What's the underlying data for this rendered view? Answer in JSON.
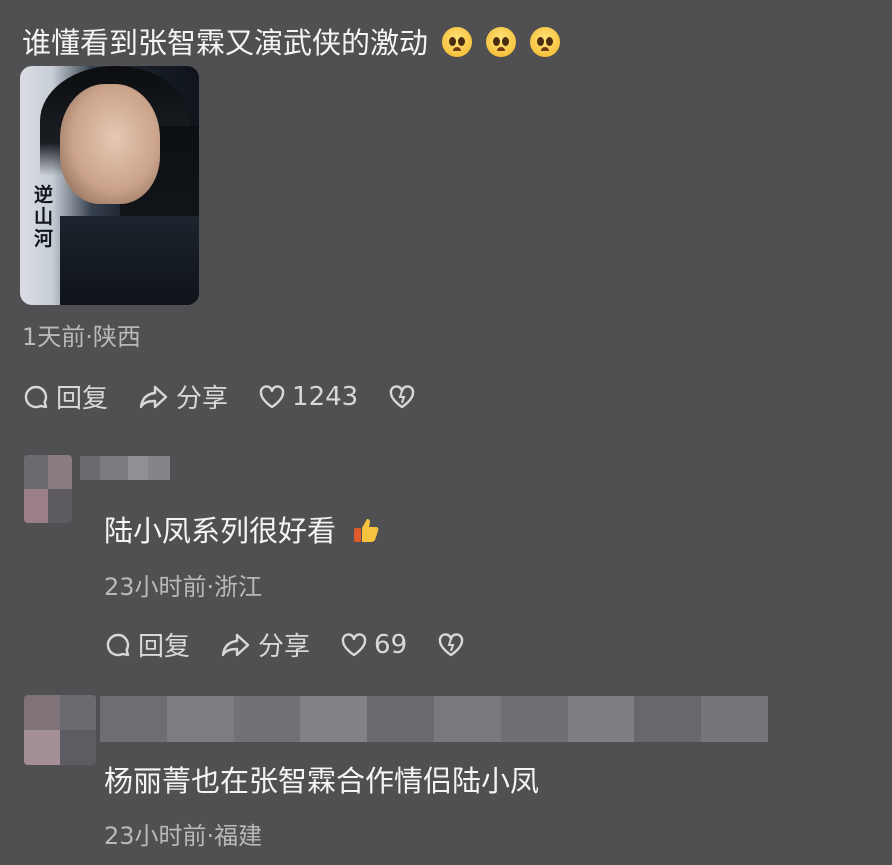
{
  "comments": [
    {
      "text": "谁懂看到张智霖又演武侠的激动",
      "emojis": [
        "pleading-face-icon",
        "pleading-face-icon",
        "pleading-face-icon"
      ],
      "meta": "1天前·陕西",
      "actions": {
        "reply": "回复",
        "share": "分享",
        "likes": "1243"
      },
      "image": {
        "poster_text": "逆山河"
      }
    },
    {
      "text": "陆小凤系列很好看",
      "emoji": "thumbs-up-icon",
      "meta": "23小时前·浙江",
      "actions": {
        "reply": "回复",
        "share": "分享",
        "likes": "69"
      }
    },
    {
      "text": "杨丽菁也在张智霖合作情侣陆小凤",
      "meta": "23小时前·福建"
    }
  ],
  "colors": {
    "background": "#505052",
    "text": "#f4f4f4",
    "meta": "#b9b9bb"
  }
}
